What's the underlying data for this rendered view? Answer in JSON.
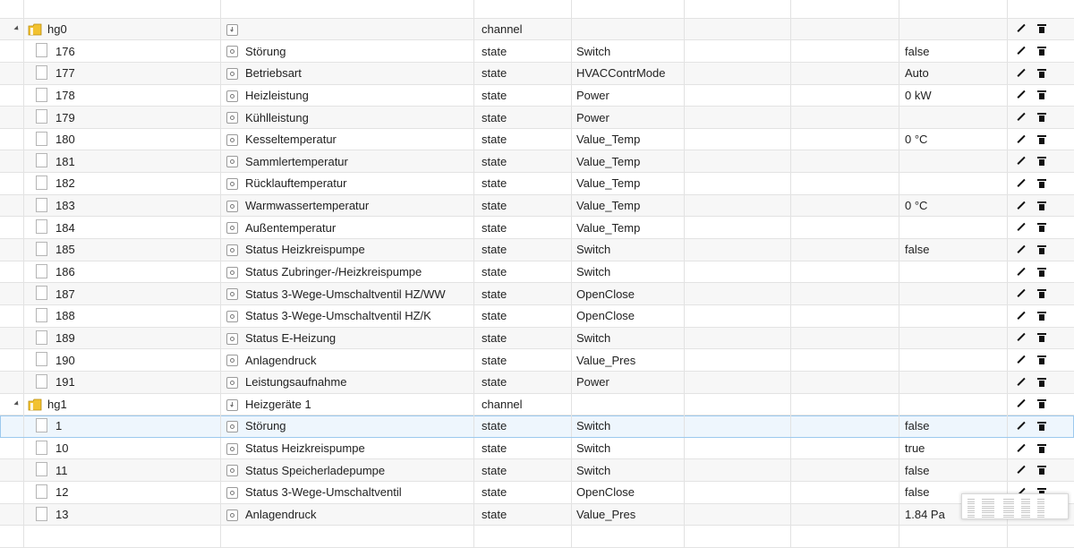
{
  "rows": [
    {
      "kind": "folder",
      "id": "",
      "name": "",
      "type": "",
      "role": "",
      "value": "",
      "partial": true
    },
    {
      "kind": "folder",
      "id": "hg0",
      "name": "",
      "type": "channel",
      "role": "",
      "value": ""
    },
    {
      "kind": "state",
      "id": "176",
      "name": "Störung",
      "type": "state",
      "role": "Switch",
      "value": "false"
    },
    {
      "kind": "state",
      "id": "177",
      "name": "Betriebsart",
      "type": "state",
      "role": "HVACContrMode",
      "value": "Auto"
    },
    {
      "kind": "state",
      "id": "178",
      "name": "Heizleistung",
      "type": "state",
      "role": "Power",
      "value": "0 kW"
    },
    {
      "kind": "state",
      "id": "179",
      "name": "Kühlleistung",
      "type": "state",
      "role": "Power",
      "value": ""
    },
    {
      "kind": "state",
      "id": "180",
      "name": "Kesseltemperatur",
      "type": "state",
      "role": "Value_Temp",
      "value": "0 °C"
    },
    {
      "kind": "state",
      "id": "181",
      "name": "Sammlertemperatur",
      "type": "state",
      "role": "Value_Temp",
      "value": ""
    },
    {
      "kind": "state",
      "id": "182",
      "name": "Rücklauftemperatur",
      "type": "state",
      "role": "Value_Temp",
      "value": ""
    },
    {
      "kind": "state",
      "id": "183",
      "name": "Warmwassertemperatur",
      "type": "state",
      "role": "Value_Temp",
      "value": "0 °C"
    },
    {
      "kind": "state",
      "id": "184",
      "name": "Außentemperatur",
      "type": "state",
      "role": "Value_Temp",
      "value": ""
    },
    {
      "kind": "state",
      "id": "185",
      "name": "Status Heizkreispumpe",
      "type": "state",
      "role": "Switch",
      "value": "false"
    },
    {
      "kind": "state",
      "id": "186",
      "name": "Status Zubringer-/Heizkreispumpe",
      "type": "state",
      "role": "Switch",
      "value": ""
    },
    {
      "kind": "state",
      "id": "187",
      "name": "Status 3-Wege-Umschaltventil HZ/WW",
      "type": "state",
      "role": "OpenClose",
      "value": ""
    },
    {
      "kind": "state",
      "id": "188",
      "name": "Status 3-Wege-Umschaltventil HZ/K",
      "type": "state",
      "role": "OpenClose",
      "value": ""
    },
    {
      "kind": "state",
      "id": "189",
      "name": "Status E-Heizung",
      "type": "state",
      "role": "Switch",
      "value": ""
    },
    {
      "kind": "state",
      "id": "190",
      "name": "Anlagendruck",
      "type": "state",
      "role": "Value_Pres",
      "value": ""
    },
    {
      "kind": "state",
      "id": "191",
      "name": "Leistungsaufnahme",
      "type": "state",
      "role": "Power",
      "value": ""
    },
    {
      "kind": "folder",
      "id": "hg1",
      "name": "Heizgeräte 1",
      "type": "channel",
      "role": "",
      "value": ""
    },
    {
      "kind": "state",
      "id": "1",
      "name": "Störung",
      "type": "state",
      "role": "Switch",
      "value": "false",
      "selected": true
    },
    {
      "kind": "state",
      "id": "10",
      "name": "Status Heizkreispumpe",
      "type": "state",
      "role": "Switch",
      "value": "true"
    },
    {
      "kind": "state",
      "id": "11",
      "name": "Status Speicherladepumpe",
      "type": "state",
      "role": "Switch",
      "value": "false"
    },
    {
      "kind": "state",
      "id": "12",
      "name": "Status 3-Wege-Umschaltventil",
      "type": "state",
      "role": "OpenClose",
      "value": "false"
    },
    {
      "kind": "state",
      "id": "13",
      "name": "Anlagendruck",
      "type": "state",
      "role": "Value_Pres",
      "value": "1.84 Pa"
    },
    {
      "kind": "state",
      "id": "",
      "name": "",
      "type": "",
      "role": "",
      "value": "",
      "partial": true
    }
  ],
  "colors": {
    "folder": "#f2c230",
    "selection": "#9cc9ee",
    "row_alt": "#f7f7f7"
  }
}
